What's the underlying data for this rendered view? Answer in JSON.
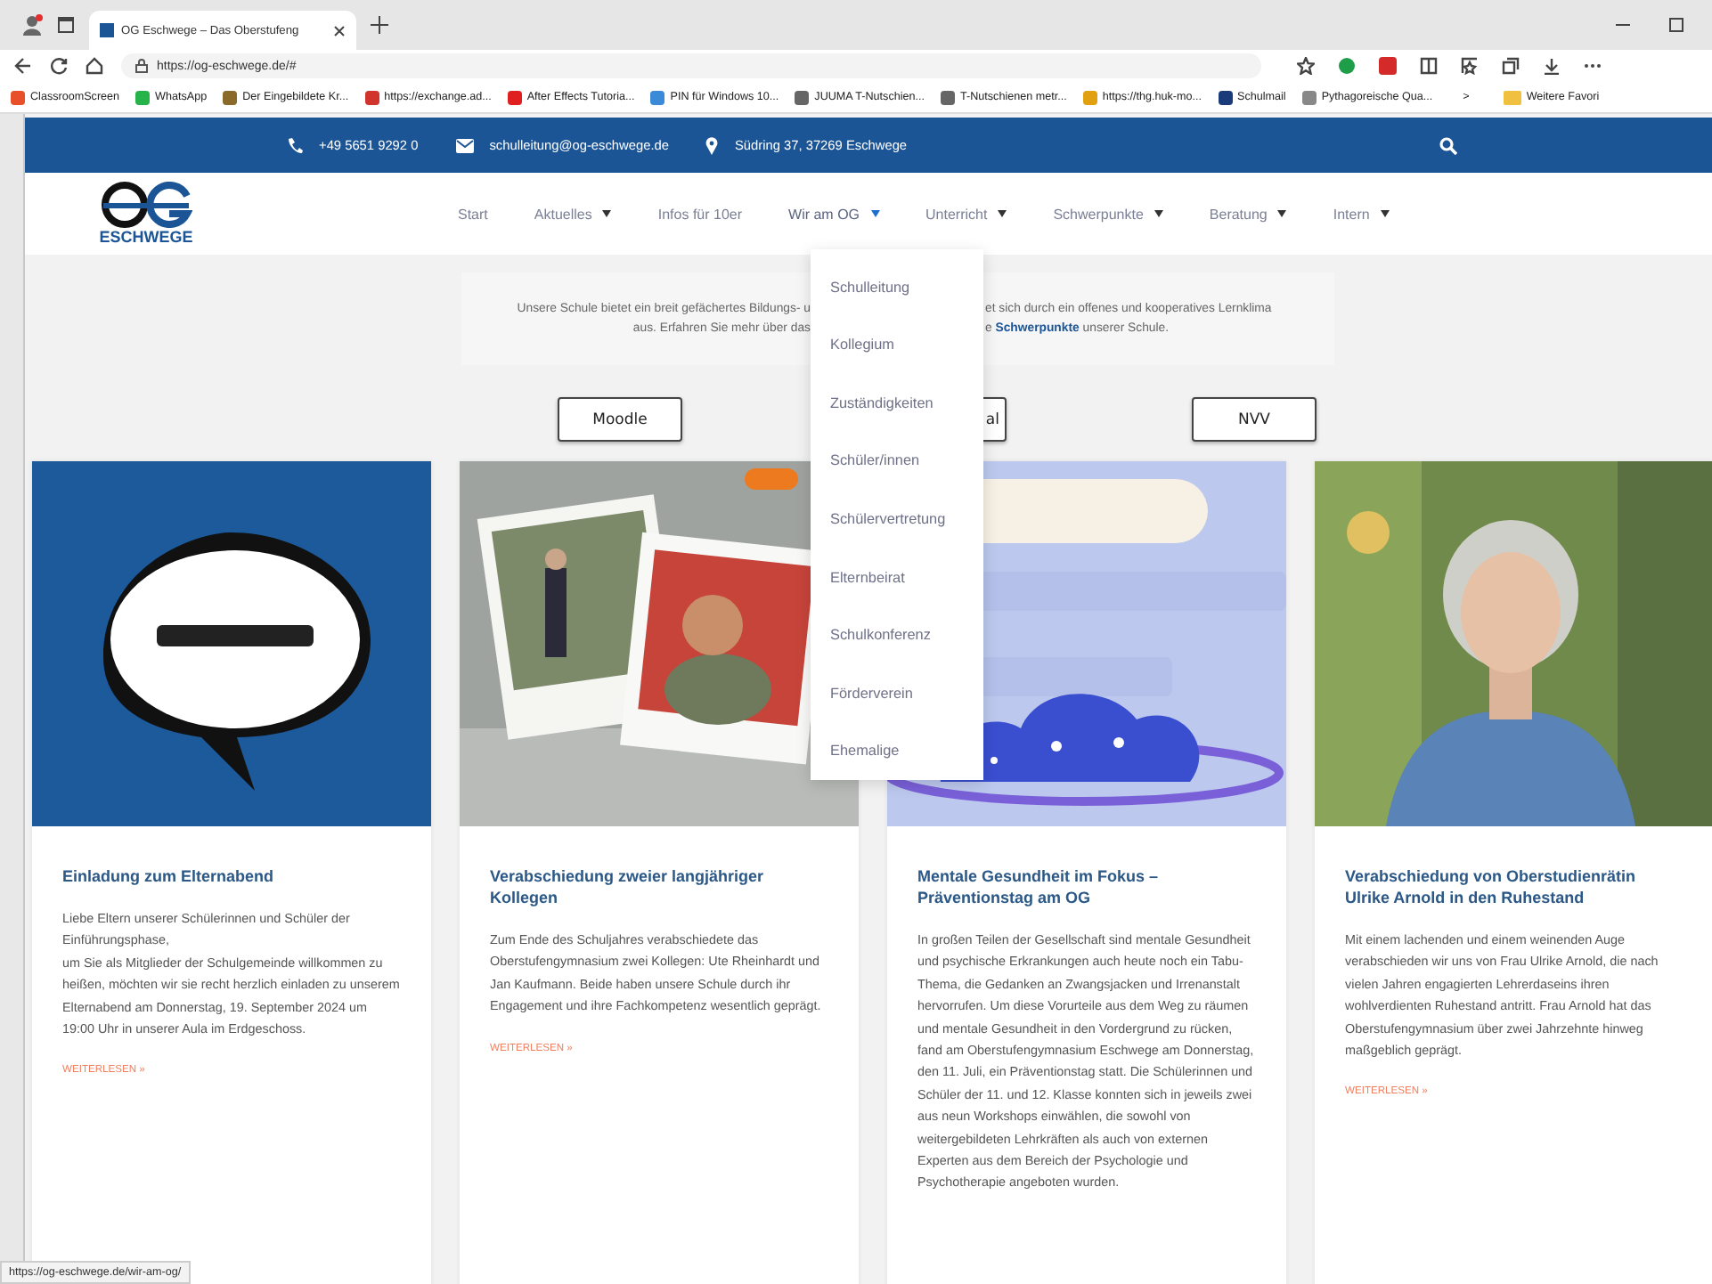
{
  "browser": {
    "tab_title": "OG Eschwege – Das Oberstufeng",
    "url": "https://og-eschwege.de/#",
    "bookmarks": [
      {
        "label": "ClassroomScreen",
        "color": "#e8502a"
      },
      {
        "label": "WhatsApp",
        "color": "#25b34a"
      },
      {
        "label": "Der Eingebildete Kr...",
        "color": "#8a6a2a"
      },
      {
        "label": "https://exchange.ad...",
        "color": "#d0342c"
      },
      {
        "label": "After Effects Tutoria...",
        "color": "#e02020"
      },
      {
        "label": "PIN für Windows 10...",
        "color": "#3a8ad8"
      },
      {
        "label": "JUUMA T-Nutschien...",
        "color": "#666666"
      },
      {
        "label": "T-Nutschienen metr...",
        "color": "#666666"
      },
      {
        "label": "https://thg.huk-mo...",
        "color": "#e0a010"
      },
      {
        "label": "Schulmail",
        "color": "#1a3a7a"
      },
      {
        "label": "Pythagoreische Qua...",
        "color": "#888888"
      }
    ],
    "more": ">",
    "more_bookmarks": "Weitere Favori"
  },
  "topbar": {
    "phone": "+49 5651 9292 0",
    "email": "schulleitung@og-eschwege.de",
    "address": "Südring 37, 37269 Eschwege"
  },
  "logo": {
    "text": "ESCHWEGE"
  },
  "nav": [
    {
      "label": "Start",
      "dropdown": false,
      "selected": false
    },
    {
      "label": "Aktuelles",
      "dropdown": true,
      "selected": false
    },
    {
      "label": "Infos für 10er",
      "dropdown": false,
      "selected": false
    },
    {
      "label": "Wir am OG",
      "dropdown": true,
      "selected": true
    },
    {
      "label": "Unterricht",
      "dropdown": true,
      "selected": false
    },
    {
      "label": "Schwerpunkte",
      "dropdown": true,
      "selected": false
    },
    {
      "label": "Beratung",
      "dropdown": true,
      "selected": false
    },
    {
      "label": "Intern",
      "dropdown": true,
      "selected": false
    }
  ],
  "submenu": [
    "Schulleitung",
    "Kollegium",
    "Zuständigkeiten",
    "Schüler/innen",
    "Schülervertretung",
    "Elternbeirat",
    "Schulkonferenz",
    "Förderverein",
    "Ehemalige"
  ],
  "intro": [
    {
      "left": "Unsere Schule bietet ein breit gefächertes Bildungs- u",
      "right": "et sich durch ein offenes und kooperatives Lernklima"
    },
    {
      "left": "aus. Erfahren Sie mehr über das",
      "right": "e **Schwerpunkte** unserer Schule."
    }
  ],
  "quick_links": [
    "Moodle",
    "al",
    "NVV"
  ],
  "posts": [
    {
      "title": "Einladung zum Elternabend",
      "body": "Liebe Eltern unserer Schülerinnen und Schüler der Einführungsphase,\num Sie als Mitglieder der Schulgemeinde willkommen zu heißen, möchten wir sie recht herzlich einladen zu unserem Elternabend am Donnerstag, 19. September 2024 um 19:00 Uhr in unserer Aula im Erdgeschoss.",
      "link": "WEITERLESEN »"
    },
    {
      "title": "Verabschiedung zweier langjähriger Kollegen",
      "body": "Zum Ende des Schuljahres verabschiedete das Oberstufengymnasium zwei Kollegen: Ute Rheinhardt und Jan Kaufmann. Beide haben unsere Schule durch ihr Engagement und ihre Fachkompetenz wesentlich geprägt.",
      "link": "WEITERLESEN »"
    },
    {
      "title": "Mentale Gesundheit im Fokus – Präventionstag am OG",
      "body": "In großen Teilen der Gesellschaft sind mentale Gesundheit und psychische Erkrankungen auch heute noch ein Tabu-Thema, die Gedanken an Zwangsjacken und Irrenanstalt hervorrufen. Um diese Vorurteile aus dem Weg zu räumen und mentale Gesundheit in den Vordergrund zu rücken, fand am Oberstufengymnasium Eschwege am Donnerstag, den 11. Juli, ein Präventionstag statt. Die Schülerinnen und Schüler der 11. und 12. Klasse konnten sich in jeweils zwei aus neun Workshops einwählen, die sowohl von weitergebildeten Lehrkräften als auch von externen Experten aus dem Bereich der Psychologie und Psychotherapie angeboten wurden."
    },
    {
      "title": "Verabschiedung von Oberstudienrätin Ulrike Arnold in den Ruhestand",
      "body": "Mit einem lachenden und einem weinenden Auge verabschieden wir uns von Frau Ulrike Arnold, die nach vielen Jahren engagierten Lehrerdaseins ihren wohlverdienten Ruhestand antritt. Frau Arnold hat das Oberstufengymnasium über zwei Jahrzehnte hinweg maßgeblich geprägt.",
      "link": "WEITERLESEN »"
    }
  ],
  "status_url": "https://og-eschwege.de/wir-am-og/"
}
